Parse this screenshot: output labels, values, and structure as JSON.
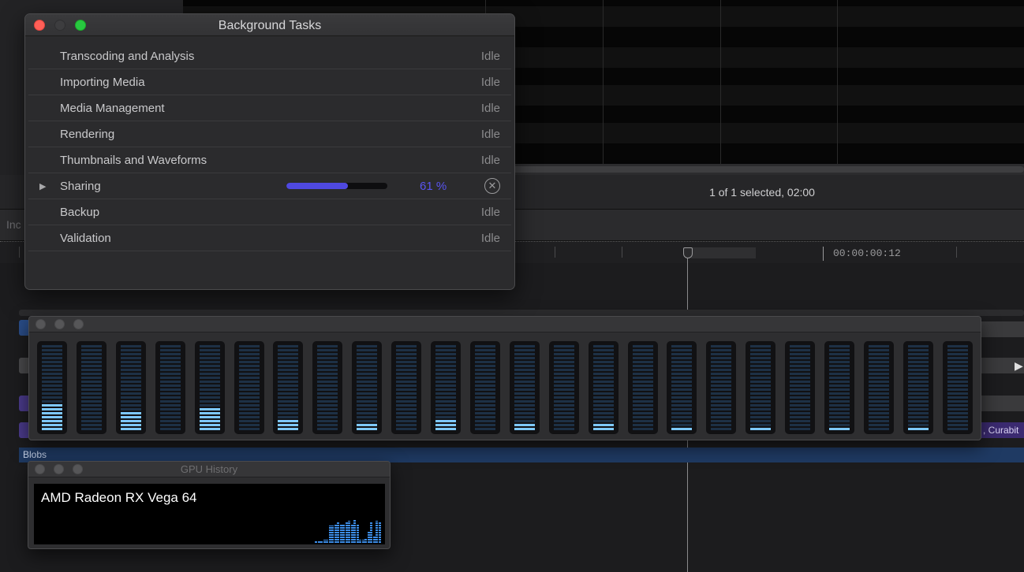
{
  "app": {
    "status_text": "1 of 1 selected, 02:00",
    "index_label": "Inc",
    "ruler_timecode": "00:00:00:12",
    "blobs_label": "Blobs",
    "clip_label": ", Curabit"
  },
  "background_tasks": {
    "title": "Background Tasks",
    "rows": [
      {
        "name": "Transcoding and Analysis",
        "state": "Idle"
      },
      {
        "name": "Importing Media",
        "state": "Idle"
      },
      {
        "name": "Media Management",
        "state": "Idle"
      },
      {
        "name": "Rendering",
        "state": "Idle"
      },
      {
        "name": "Thumbnails and Waveforms",
        "state": "Idle"
      },
      {
        "name": "Sharing",
        "state": "",
        "progress": 0.61,
        "progress_label": "61 %",
        "disclosure": "▶",
        "cancel_glyph": "✕"
      },
      {
        "name": "Backup",
        "state": "Idle"
      },
      {
        "name": "Validation",
        "state": "Idle"
      }
    ]
  },
  "gpu_activity": {
    "levels": [
      0.34,
      0,
      0.24,
      0,
      0.29,
      0,
      0.14,
      0,
      0.09,
      0,
      0.14,
      0,
      0.09,
      0,
      0.09,
      0,
      0.04,
      0,
      0.04,
      0,
      0.04,
      0,
      0.04,
      0
    ],
    "colors": {
      "lit": "#7ec8ff",
      "unlit": "#1d3045"
    }
  },
  "gpu_history": {
    "title": "GPU History",
    "gpu_name": "AMD Radeon RX Vega 64",
    "samples": [
      0,
      0,
      0,
      0,
      0.08,
      0.08,
      0.08,
      0.1,
      0.1,
      0.55,
      0.55,
      0.6,
      0.65,
      0.6,
      0.6,
      0.65,
      0.7,
      0.6,
      0.75,
      0.6,
      0.1,
      0.1,
      0.15,
      0.35,
      0.65,
      0.2,
      0.7,
      0.65
    ],
    "bar_color": "#3c8de8"
  }
}
